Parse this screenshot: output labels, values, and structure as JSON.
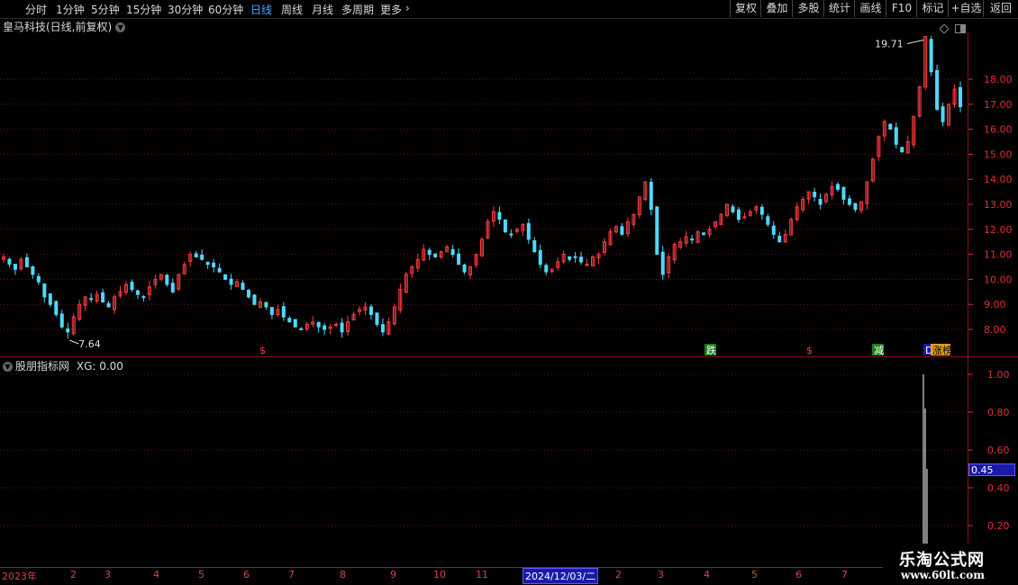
{
  "toolbar": {
    "periods": [
      "分时",
      "1分钟",
      "5分钟",
      "15分钟",
      "30分钟",
      "60分钟",
      "日线",
      "周线",
      "月线",
      "多周期",
      "更多"
    ],
    "active_period": "日线",
    "buttons": [
      "复权",
      "叠加",
      "多股",
      "统计",
      "画线",
      "F10",
      "标记",
      "+自选",
      "返回"
    ]
  },
  "stock_title": "皇马科技(日线,前复权)",
  "colors": {
    "up": "#ff3c3c",
    "down": "#4fd8ff",
    "grid": "#7a1010",
    "axis": "#e03030"
  },
  "main_chart": {
    "y_axis_labels": [
      "18.00",
      "17.00",
      "16.00",
      "15.00",
      "14.00",
      "13.00",
      "12.00",
      "11.00",
      "10.00",
      "9.00",
      "8.00"
    ],
    "high_annotation": "19.71",
    "low_annotation": "7.64",
    "markers": [
      {
        "text": "$",
        "color": "#ff3c3c",
        "bg": "none"
      },
      {
        "text": "跌",
        "color": "#ffffff",
        "bg": "#1b7f1b"
      },
      {
        "text": "$",
        "color": "#ff3c3c",
        "bg": "none"
      },
      {
        "text": "减",
        "color": "#ffffff",
        "bg": "#1b7f1b"
      },
      {
        "text": "D",
        "color": "#ffffff",
        "bg": "#1a1aa8"
      },
      {
        "text": "涨榜",
        "color": "#000000",
        "bg": "#e0a020"
      }
    ]
  },
  "indicator": {
    "name": "股朋指标网",
    "value_text": "XG: 0.00",
    "y_axis_labels": [
      "1.00",
      "0.80",
      "0.60",
      "0.40",
      "0.20"
    ],
    "cursor_value": "0.45"
  },
  "date_axis": {
    "ticks": [
      "2023年",
      "2",
      "3",
      "4",
      "5",
      "6",
      "7",
      "8",
      "9",
      "10",
      "11",
      "2024/12/03/二",
      "2",
      "3",
      "4",
      "5",
      "6",
      "7"
    ],
    "selected": "2024/12/03/二"
  },
  "watermark": {
    "line1": "乐淘公式网",
    "line2": "www.60lt.com"
  },
  "chart_data": {
    "type": "candlestick",
    "title": "皇马科技(日线,前复权)",
    "ylim": [
      7.3,
      20.0
    ],
    "high": 19.71,
    "low": 7.64,
    "close_path": [
      10.9,
      10.6,
      10.4,
      10.8,
      10.5,
      10.2,
      9.9,
      9.3,
      9.0,
      8.6,
      8.1,
      7.9,
      8.5,
      9.0,
      9.3,
      9.2,
      9.4,
      9.1,
      8.9,
      9.3,
      9.5,
      9.8,
      9.6,
      9.4,
      9.3,
      9.7,
      10.0,
      10.2,
      9.8,
      9.5,
      10.2,
      10.6,
      11.0,
      10.9,
      10.8,
      10.6,
      10.5,
      10.3,
      10.0,
      9.8,
      9.9,
      9.6,
      9.3,
      9.0,
      9.1,
      8.9,
      8.6,
      8.8,
      8.5,
      8.3,
      8.1,
      8.0,
      8.2,
      8.3,
      8.1,
      8.0,
      8.1,
      8.2,
      7.9,
      8.3,
      8.6,
      8.8,
      8.9,
      8.6,
      8.2,
      7.9,
      8.3,
      8.9,
      9.6,
      10.2,
      10.5,
      10.8,
      11.2,
      11.0,
      10.9,
      11.1,
      11.3,
      11.0,
      10.6,
      10.3,
      10.5,
      11.0,
      11.6,
      12.3,
      12.7,
      12.4,
      11.9,
      11.8,
      12.0,
      12.2,
      11.6,
      11.1,
      10.6,
      10.3,
      10.4,
      10.7,
      11.0,
      10.8,
      10.9,
      10.7,
      10.6,
      10.9,
      11.0,
      11.5,
      11.9,
      12.1,
      11.8,
      12.3,
      12.6,
      13.3,
      13.9,
      12.8,
      11.0,
      10.2,
      10.9,
      11.4,
      11.5,
      11.7,
      11.6,
      11.9,
      11.8,
      12.0,
      12.3,
      12.6,
      13.0,
      12.7,
      12.4,
      12.5,
      12.7,
      12.9,
      12.6,
      12.2,
      11.8,
      11.5,
      11.8,
      12.4,
      12.9,
      13.2,
      13.5,
      13.3,
      13.0,
      13.4,
      13.7,
      13.6,
      13.2,
      13.0,
      12.8,
      13.1,
      13.9,
      14.8,
      15.7,
      16.3,
      16.0,
      15.4,
      15.1,
      15.5,
      16.5,
      17.7,
      19.71,
      18.3,
      16.8,
      16.3,
      17.0,
      17.6,
      16.9
    ]
  }
}
